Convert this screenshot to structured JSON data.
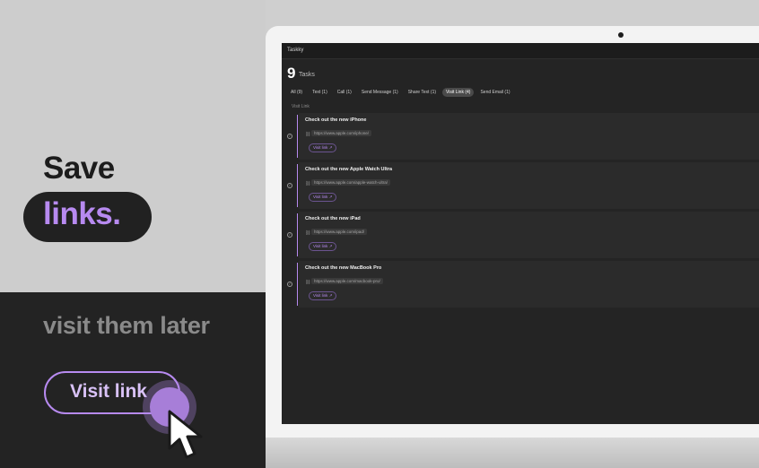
{
  "promo": {
    "headline_1": "Save",
    "headline_2": "links.",
    "subline": "visit them later",
    "cta_label": "Visit link"
  },
  "app": {
    "title": "Taskky",
    "task_count": "9",
    "task_count_label": "Tasks",
    "filters": [
      {
        "label": "All (9)",
        "active": false
      },
      {
        "label": "Text (1)",
        "active": false
      },
      {
        "label": "Call (1)",
        "active": false
      },
      {
        "label": "Send Message (1)",
        "active": false
      },
      {
        "label": "Share Text (1)",
        "active": false
      },
      {
        "label": "Visit Link (4)",
        "active": true
      },
      {
        "label": "Send Email (1)",
        "active": false
      }
    ],
    "group_label": "Visit Link",
    "tasks": [
      {
        "title": "Check out the new iPhone",
        "url": "https://www.apple.com/iphone/",
        "action": "Visit link"
      },
      {
        "title": "Check out the new Apple Watch Ultra",
        "url": "https://www.apple.com/apple-watch-ultra/",
        "action": "Visit link"
      },
      {
        "title": "Check out the new iPad",
        "url": "https://www.apple.com/ipad/",
        "action": "Visit link"
      },
      {
        "title": "Check out the new MacBook Pro",
        "url": "https://www.apple.com/macbook-pro/",
        "action": "Visit link"
      }
    ]
  },
  "colors": {
    "accent": "#b78af0",
    "screen_bg": "#242424",
    "promo_dark": "#232323"
  }
}
